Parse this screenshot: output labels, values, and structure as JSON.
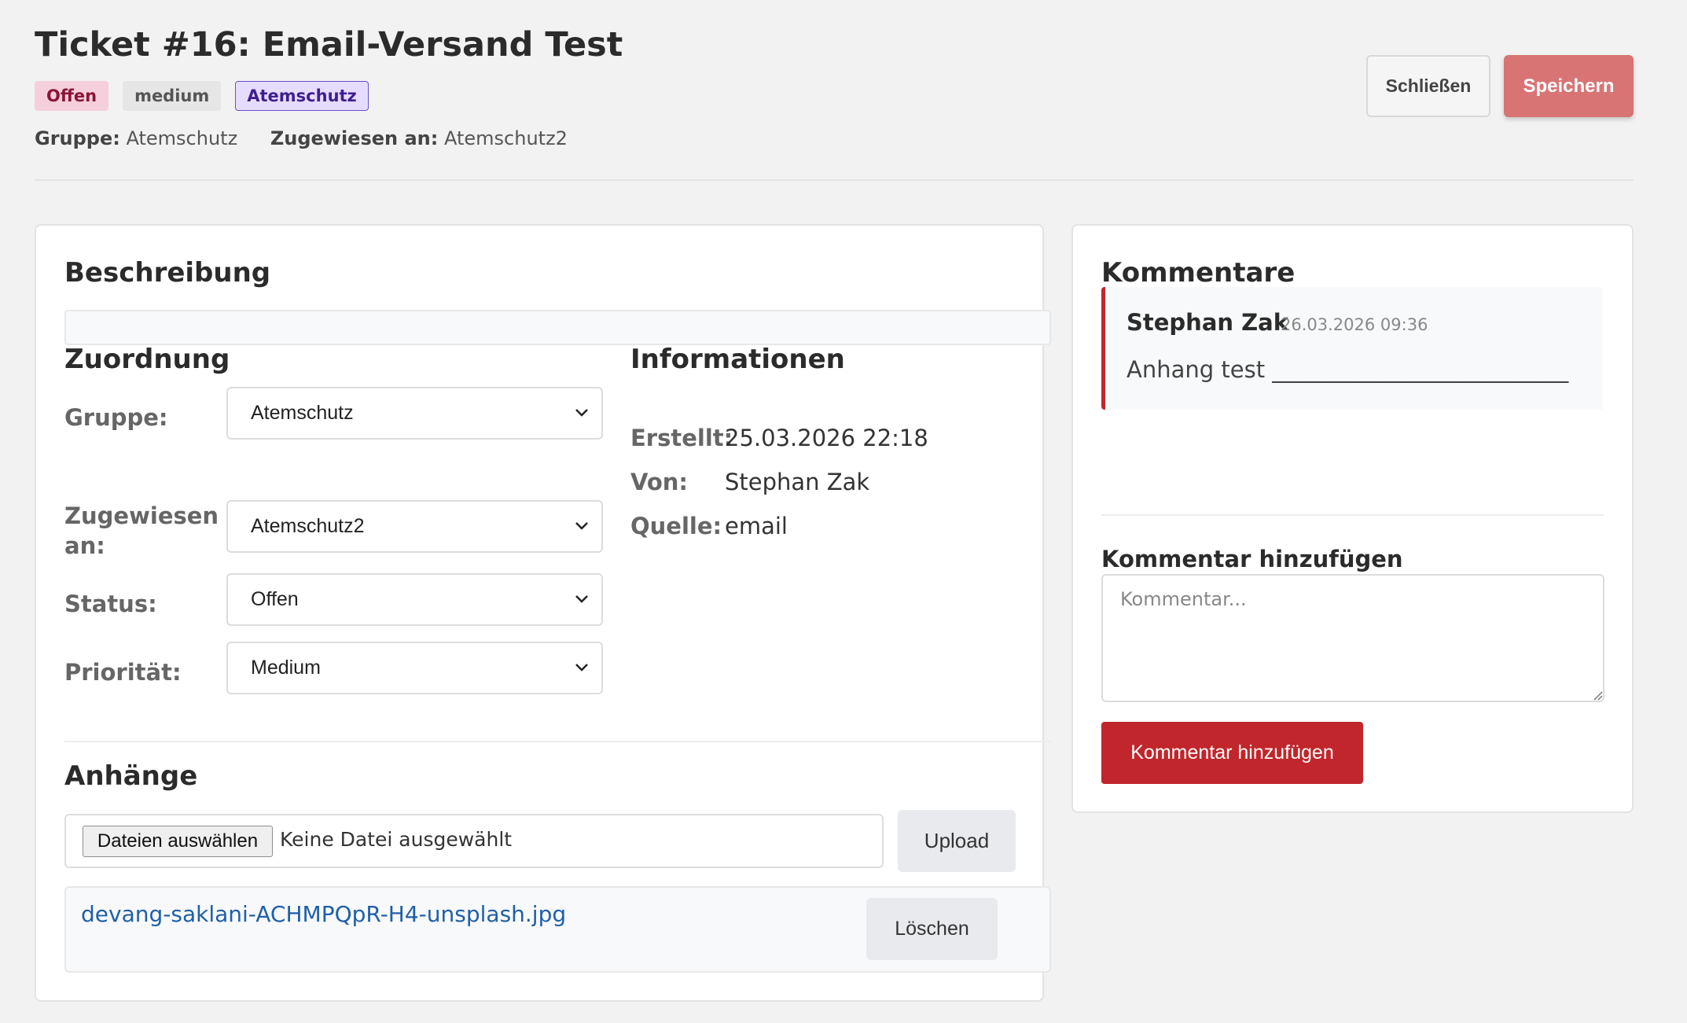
{
  "ticket": {
    "title": "Ticket #16: Email-Versand Test",
    "badges": {
      "status": "Offen",
      "priority": "medium",
      "group": "Atemschutz"
    },
    "meta": {
      "group_label": "Gruppe:",
      "group_value": "Atemschutz",
      "assigned_label": "Zugewiesen an:",
      "assigned_value": "Atemschutz2"
    }
  },
  "actions": {
    "close_label": "Schließen",
    "save_label": "Speichern"
  },
  "description": {
    "heading": "Beschreibung",
    "text": ""
  },
  "assignment": {
    "heading": "Zuordnung",
    "fields": [
      {
        "label": "Gruppe:",
        "value": "Atemschutz"
      },
      {
        "label": "Zugewiesen an:",
        "value": "Atemschutz2"
      },
      {
        "label": "Status:",
        "value": "Offen"
      },
      {
        "label": "Priorität:",
        "value": "Medium"
      }
    ]
  },
  "info": {
    "heading": "Informationen",
    "rows": [
      {
        "key": "Erstellt:",
        "value": "25.03.2026 22:18"
      },
      {
        "key": "Von:",
        "value": "Stephan Zak"
      },
      {
        "key": "Quelle:",
        "value": "email"
      }
    ]
  },
  "attachments": {
    "heading": "Anhänge",
    "choose_label": "Dateien auswählen",
    "no_file_text": "Keine Datei ausgewählt",
    "upload_label": "Upload",
    "files": [
      {
        "name": "devang-saklani-ACHMPQpR-H4-unsplash.jpg",
        "delete_label": "Löschen"
      }
    ]
  },
  "comments": {
    "heading": "Kommentare",
    "items": [
      {
        "author": "Stephan Zak",
        "time": "26.03.2026 09:36",
        "text": "Anhang test __________________________"
      }
    ],
    "add_heading": "Kommentar hinzufügen",
    "placeholder": "Kommentar...",
    "add_button": "Kommentar hinzufügen"
  },
  "colors": {
    "accent_red": "#c0262b",
    "save_button": "#d97474",
    "link": "#1f5fa8",
    "status_badge_bg": "#f6cfdc",
    "group_badge_bg": "#e6dcff"
  },
  "icons": {
    "select_arrow": "chevron-down-icon",
    "resize_grip": "resize-grip-icon"
  }
}
